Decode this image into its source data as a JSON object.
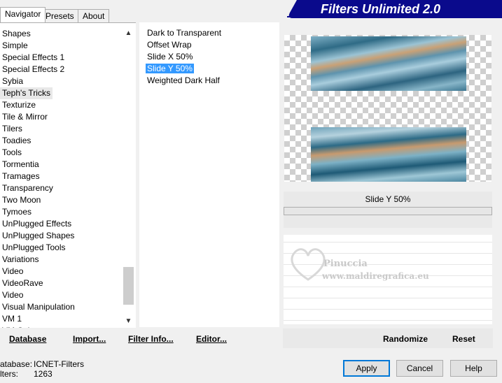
{
  "header": {
    "title": "Filters Unlimited 2.0",
    "bg_color": "#0a0a8c"
  },
  "tabs": [
    {
      "label": "Navigator",
      "active": true
    },
    {
      "label": "Presets",
      "active": false
    },
    {
      "label": "About",
      "active": false
    }
  ],
  "categories": {
    "items": [
      "Shapes",
      "Simple",
      "Special Effects 1",
      "Special Effects 2",
      "Sybia",
      "Teph's Tricks",
      "Texturize",
      "Tile & Mirror",
      "Tilers",
      "Toadies",
      "Tools",
      "Tormentia",
      "Tramages",
      "Transparency",
      "Two Moon",
      "Tymoes",
      "UnPlugged Effects",
      "UnPlugged Shapes",
      "UnPlugged Tools",
      "Variations",
      "Video",
      "VideoRave",
      "Video",
      "Visual Manipulation",
      "VM 1"
    ],
    "selected": "Teph's Tricks",
    "partial_item": "VM Color"
  },
  "filters": {
    "items": [
      "Dark to Transparent",
      "Offset Wrap",
      "Slide X 50%",
      "Slide Y 50%",
      "Weighted Dark Half"
    ],
    "selected": "Slide Y 50%"
  },
  "preview": {
    "filter_name": "Slide Y 50%",
    "watermark_line1": "Pinuccia",
    "watermark_line2": "www.maldiregrafica.eu"
  },
  "toolbar": {
    "database": "Database",
    "import": "Import...",
    "filter_info": "Filter Info...",
    "editor": "Editor...",
    "randomize": "Randomize",
    "reset": "Reset"
  },
  "status": {
    "database_label": "atabase:",
    "database_value": "ICNET-Filters",
    "filters_label": "lters:",
    "filters_value": "1263"
  },
  "buttons": {
    "apply": "Apply",
    "cancel": "Cancel",
    "help": "Help"
  },
  "icons": {
    "scroll_up": "▲",
    "scroll_down": "▼"
  }
}
